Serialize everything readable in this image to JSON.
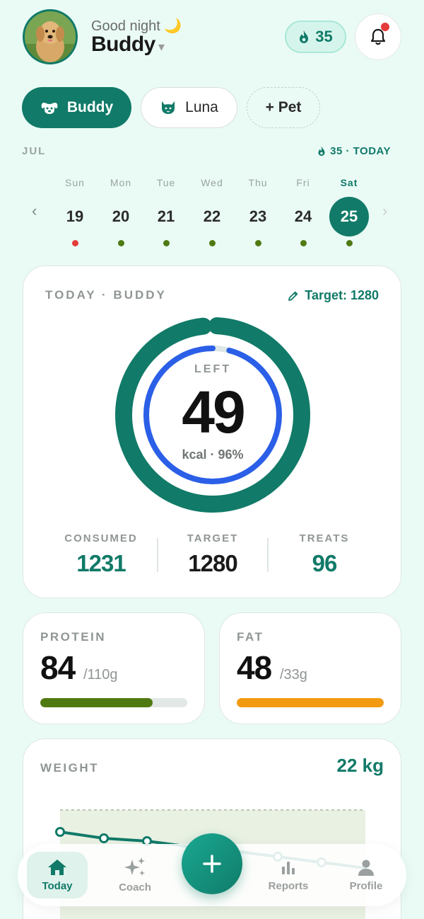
{
  "header": {
    "greeting": "Good night",
    "greeting_emoji": "🌙",
    "pet_name": "Buddy",
    "streak_count": "35"
  },
  "pets": {
    "items": [
      {
        "label": "Buddy",
        "icon": "dog-icon",
        "selected": true
      },
      {
        "label": "Luna",
        "icon": "cat-icon",
        "selected": false
      }
    ],
    "add_label": "+ Pet"
  },
  "calendar": {
    "month": "JUL",
    "streak_label": "35 · TODAY",
    "days": [
      {
        "name": "Sun",
        "num": "19",
        "status": "missed"
      },
      {
        "name": "Mon",
        "num": "20",
        "status": "ok"
      },
      {
        "name": "Tue",
        "num": "21",
        "status": "ok"
      },
      {
        "name": "Wed",
        "num": "22",
        "status": "ok"
      },
      {
        "name": "Thu",
        "num": "23",
        "status": "ok"
      },
      {
        "name": "Fri",
        "num": "24",
        "status": "ok"
      },
      {
        "name": "Sat",
        "num": "25",
        "status": "ok",
        "selected": true
      }
    ]
  },
  "today": {
    "label": "TODAY · BUDDY",
    "target_link": "Target: 1280",
    "left_label": "LEFT",
    "left_value": "49",
    "left_sub": "kcal · 96%",
    "progress_fraction": 0.96,
    "stats": [
      {
        "label": "CONSUMED",
        "value": "1231"
      },
      {
        "label": "TARGET",
        "value": "1280"
      },
      {
        "label": "TREATS",
        "value": "96"
      }
    ]
  },
  "macros": {
    "protein": {
      "label": "PROTEIN",
      "value": "84",
      "target": "/110g",
      "fraction": 0.764
    },
    "fat": {
      "label": "FAT",
      "value": "48",
      "target": "/33g",
      "fraction": 1.0
    }
  },
  "weight": {
    "label": "WEIGHT",
    "value": "22 kg",
    "faded_label": "22 kg"
  },
  "nav": {
    "today": "Today",
    "coach": "Coach",
    "reports": "Reports",
    "profile": "Profile"
  },
  "colors": {
    "brand": "#117a68",
    "ring_inner": "#2b5fe8",
    "protein": "#4f7a12",
    "fat": "#f29b10",
    "missed": "#e53b3b",
    "ok": "#4f7a12"
  }
}
